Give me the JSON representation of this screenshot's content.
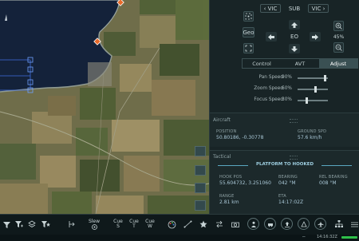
{
  "map": {
    "map_alt": "Satellite map of coastline and farmland"
  },
  "ptz": {
    "vic_left_label": "VIC",
    "sub_label": "SUB",
    "vic_right_label": "VIC",
    "geo_label": "Geo",
    "eo_label": "EO",
    "zoom_level": "45%"
  },
  "tabs": [
    {
      "label": "Control",
      "active": false
    },
    {
      "label": "AVT",
      "active": false
    },
    {
      "label": "Adjust",
      "active": true
    }
  ],
  "sliders": [
    {
      "label": "Pan Speed",
      "value": "90%",
      "fraction": 0.9
    },
    {
      "label": "Zoom Speed",
      "value": "60%",
      "fraction": 0.6
    },
    {
      "label": "Focus Speed",
      "value": "30%",
      "fraction": 0.3
    }
  ],
  "aircraft": {
    "title": "Aircraft",
    "position_label": "POSITION",
    "position_value": "50.80186, -0.30778",
    "ground_spd_label": "GROUND SPD",
    "ground_spd_value": "57.6 km/h"
  },
  "tactical": {
    "title": "Tactical",
    "banner": "PLATFORM TO HOOKED",
    "hook_pos_label": "HOOK POS",
    "hook_pos_value": "55.604732, 3.251060",
    "bearing_label": "BEARING",
    "bearing_value": "042 °M",
    "rel_bearing_label": "REL BEARING",
    "rel_bearing_value": "008 °M",
    "range_label": "RANGE",
    "range_value": "2.81 km",
    "eta_label": "ETA",
    "eta_value": "14:17:02Z"
  },
  "toolbar": {
    "slew_label": "Slew",
    "cue1_label": "Cue",
    "cue1_sub": "S",
    "cue2_label": "Cue",
    "cue2_sub": "T",
    "cue3_label": "Cue",
    "cue3_sub": "W",
    "time": "14:16:32Z",
    "accent": "#2fbf4a"
  }
}
